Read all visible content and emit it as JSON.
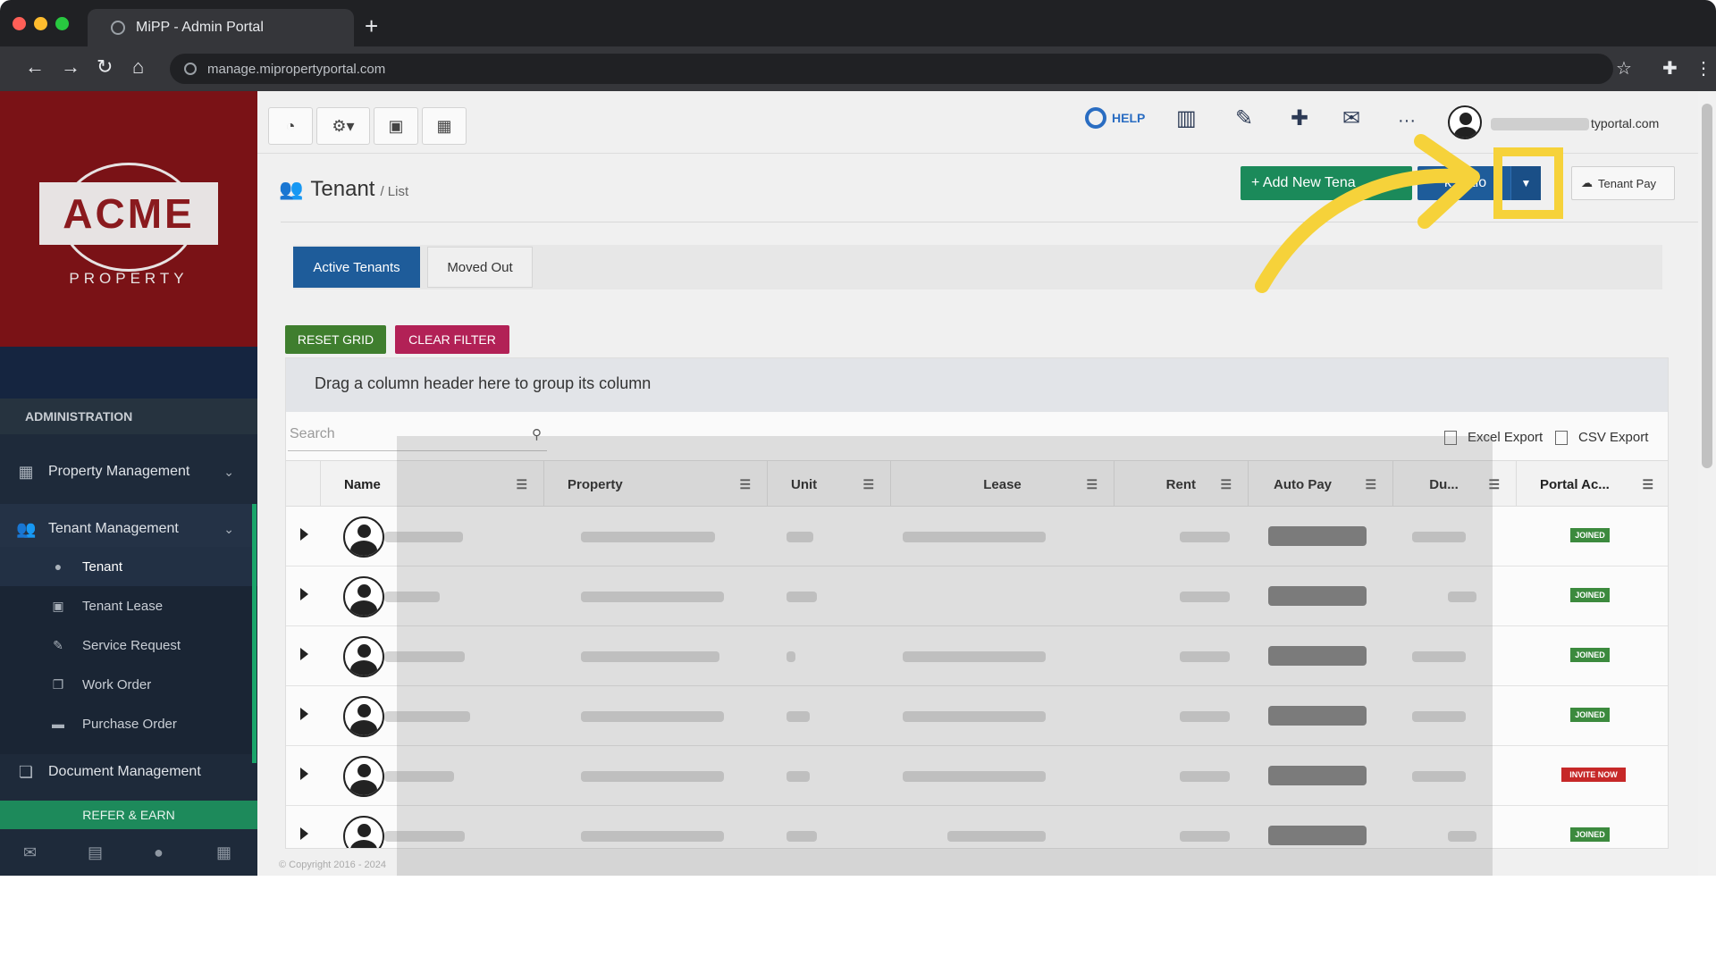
{
  "browser": {
    "tab_title": "MiPP - Admin Portal",
    "new_tab": "+",
    "url": "manage.mipropertyportal.com"
  },
  "logo": {
    "name": "ACME",
    "tagline": "PROPERTY"
  },
  "sidebar": {
    "section": "ADMINISTRATION",
    "items": [
      {
        "label": "Property Management",
        "icon": "building-icon"
      },
      {
        "label": "Tenant Management",
        "icon": "users-icon"
      },
      {
        "label": "Document Management",
        "icon": "documents-icon"
      }
    ],
    "subitems": [
      {
        "label": "Tenant",
        "icon": "user-icon"
      },
      {
        "label": "Tenant Lease",
        "icon": "calendar-check-icon"
      },
      {
        "label": "Service Request",
        "icon": "wrench-icon"
      },
      {
        "label": "Work Order",
        "icon": "copy-icon"
      },
      {
        "label": "Purchase Order",
        "icon": "truck-icon"
      }
    ],
    "refer": "REFER & EARN"
  },
  "topbar": {
    "help": "HELP",
    "more": "···",
    "user_suffix": "typortal.com"
  },
  "page": {
    "title": "Tenant",
    "subtitle": "/ List",
    "add_button": "+ Add New Tena",
    "bulk_button": "k Actio",
    "tenant_pay": "Tenant Pay"
  },
  "tabs": {
    "active": "Active Tenants",
    "moved": "Moved Out"
  },
  "actions": {
    "reset": "RESET GRID",
    "clear": "CLEAR FILTER"
  },
  "grid": {
    "group_hint": "Drag a column header here to group its column",
    "search_placeholder": "Search",
    "excel_export": "Excel Export",
    "csv_export": "CSV Export",
    "columns": [
      "Name",
      "Property",
      "Unit",
      "Lease",
      "Rent",
      "Auto Pay",
      "Du...",
      "Portal Ac..."
    ],
    "rows": [
      {
        "portal_status": "JOINED"
      },
      {
        "portal_status": "JOINED"
      },
      {
        "portal_status": "JOINED"
      },
      {
        "portal_status": "JOINED"
      },
      {
        "portal_status": "INVITE NOW"
      },
      {
        "portal_status": "JOINED"
      }
    ]
  },
  "footer": {
    "copyright": "© Copyright 2016 - 2024"
  },
  "colors": {
    "brand_red": "#7a1216",
    "primary_blue": "#1e5c9a",
    "success_green": "#1b8a5a",
    "highlight_yellow": "#f6d23a"
  }
}
